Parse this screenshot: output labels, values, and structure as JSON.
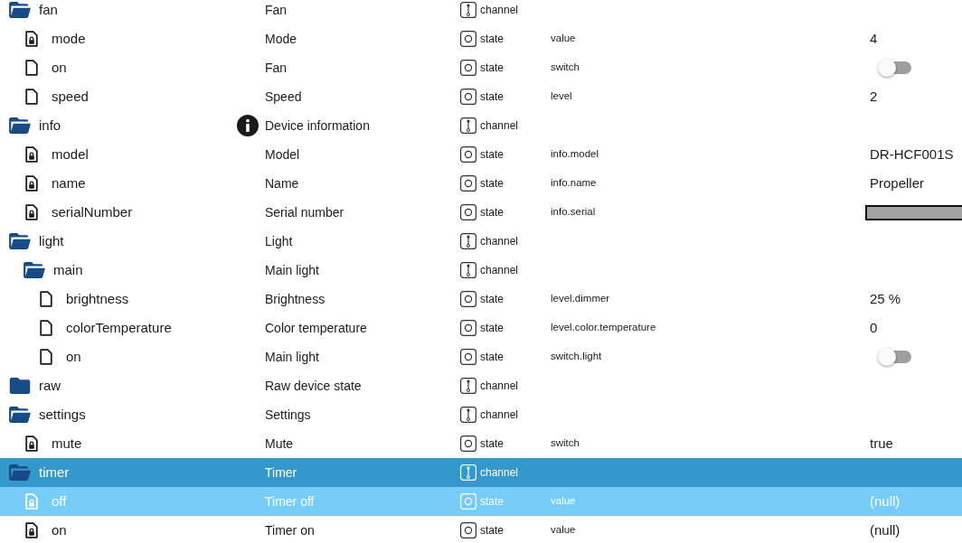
{
  "tree": [
    {
      "id": "fan",
      "name": "Fan",
      "kind": "channel",
      "type": "channel",
      "expanded": true,
      "info_icon": false,
      "selected": false,
      "hovered": false,
      "children": [
        {
          "id": "mode",
          "name": "Mode",
          "kind": "state",
          "type": "state",
          "role": "value",
          "locked": true,
          "info_icon": false,
          "selected": false,
          "hovered": false,
          "value": {
            "kind": "text",
            "text": "4"
          }
        },
        {
          "id": "on",
          "name": "Fan",
          "kind": "state",
          "type": "state",
          "role": "switch",
          "locked": false,
          "info_icon": false,
          "selected": false,
          "hovered": false,
          "value": {
            "kind": "switch",
            "on": false
          }
        },
        {
          "id": "speed",
          "name": "Speed",
          "kind": "state",
          "type": "state",
          "role": "level",
          "locked": false,
          "info_icon": false,
          "selected": false,
          "hovered": false,
          "value": {
            "kind": "text",
            "text": "2"
          }
        }
      ]
    },
    {
      "id": "info",
      "name": "Device information",
      "kind": "channel",
      "type": "channel",
      "expanded": true,
      "info_icon": true,
      "selected": false,
      "hovered": false,
      "children": [
        {
          "id": "model",
          "name": "Model",
          "kind": "state",
          "type": "state",
          "role": "info.model",
          "locked": true,
          "info_icon": false,
          "selected": false,
          "hovered": false,
          "value": {
            "kind": "text",
            "text": "DR-HCF001S"
          }
        },
        {
          "id": "name",
          "name": "Name",
          "kind": "state",
          "type": "state",
          "role": "info.name",
          "locked": true,
          "info_icon": false,
          "selected": false,
          "hovered": false,
          "value": {
            "kind": "text",
            "text": "Propeller"
          }
        },
        {
          "id": "serialNumber",
          "name": "Serial number",
          "kind": "state",
          "type": "state",
          "role": "info.serial",
          "locked": true,
          "info_icon": false,
          "selected": false,
          "hovered": false,
          "value": {
            "kind": "masked"
          }
        }
      ]
    },
    {
      "id": "light",
      "name": "Light",
      "kind": "channel",
      "type": "channel",
      "expanded": true,
      "info_icon": false,
      "selected": false,
      "hovered": false,
      "children": [
        {
          "id": "main",
          "name": "Main light",
          "kind": "channel",
          "type": "channel",
          "expanded": true,
          "info_icon": false,
          "selected": false,
          "hovered": false,
          "children": [
            {
              "id": "brightness",
              "name": "Brightness",
              "kind": "state",
              "type": "state",
              "role": "level.dimmer",
              "locked": false,
              "info_icon": false,
              "selected": false,
              "hovered": false,
              "value": {
                "kind": "text",
                "text": "25 %"
              }
            },
            {
              "id": "colorTemperature",
              "name": "Color temperature",
              "kind": "state",
              "type": "state",
              "role": "level.color.temperature",
              "locked": false,
              "info_icon": false,
              "selected": false,
              "hovered": false,
              "value": {
                "kind": "text",
                "text": "0"
              }
            },
            {
              "id": "on",
              "name": "Main light",
              "kind": "state",
              "type": "state",
              "role": "switch.light",
              "locked": false,
              "info_icon": false,
              "selected": false,
              "hovered": false,
              "value": {
                "kind": "switch",
                "on": false
              }
            }
          ]
        }
      ]
    },
    {
      "id": "raw",
      "name": "Raw device state",
      "kind": "channel",
      "type": "channel",
      "expanded": false,
      "info_icon": false,
      "selected": false,
      "hovered": false
    },
    {
      "id": "settings",
      "name": "Settings",
      "kind": "channel",
      "type": "channel",
      "expanded": true,
      "info_icon": false,
      "selected": false,
      "hovered": false,
      "children": [
        {
          "id": "mute",
          "name": "Mute",
          "kind": "state",
          "type": "state",
          "role": "switch",
          "locked": true,
          "info_icon": false,
          "selected": false,
          "hovered": false,
          "value": {
            "kind": "text",
            "text": "true"
          }
        }
      ]
    },
    {
      "id": "timer",
      "name": "Timer",
      "kind": "channel",
      "type": "channel",
      "expanded": true,
      "info_icon": false,
      "selected": true,
      "hovered": false,
      "children": [
        {
          "id": "off",
          "name": "Timer off",
          "kind": "state",
          "type": "state",
          "role": "value",
          "locked": true,
          "info_icon": false,
          "selected": false,
          "hovered": true,
          "value": {
            "kind": "text",
            "text": "(null)"
          }
        },
        {
          "id": "on",
          "name": "Timer on",
          "kind": "state",
          "type": "state",
          "role": "value",
          "locked": true,
          "info_icon": false,
          "selected": false,
          "hovered": false,
          "value": {
            "kind": "text",
            "text": "(null)"
          }
        }
      ]
    }
  ]
}
